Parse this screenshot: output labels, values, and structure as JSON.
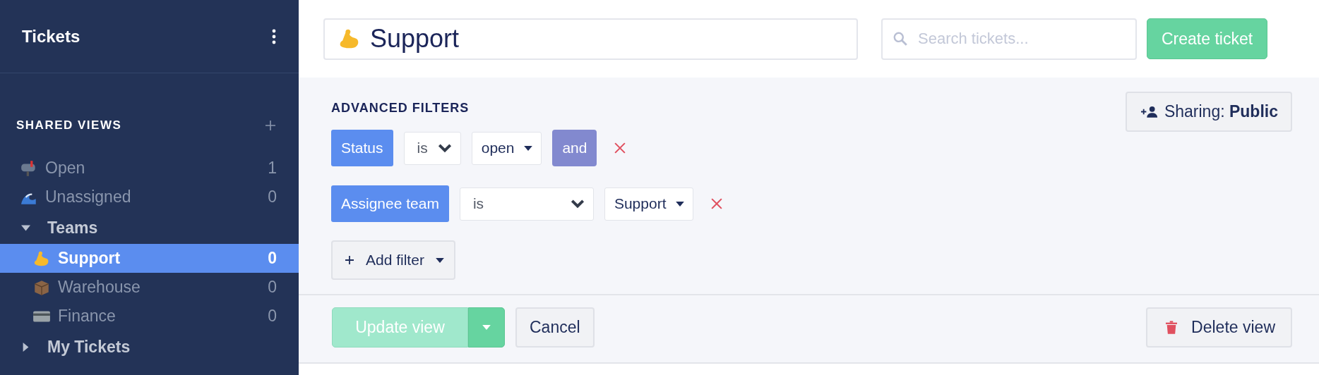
{
  "sidebar": {
    "title": "Tickets",
    "section_title": "SHARED VIEWS",
    "items": [
      {
        "label": "Open",
        "count": "1",
        "selected": false
      },
      {
        "label": "Unassigned",
        "count": "0",
        "selected": false
      },
      {
        "label": "Teams",
        "expanded": true,
        "selected": false,
        "children": [
          {
            "label": "Support",
            "count": "0",
            "selected": true
          },
          {
            "label": "Warehouse",
            "count": "0",
            "selected": false
          },
          {
            "label": "Finance",
            "count": "0",
            "selected": false
          }
        ]
      },
      {
        "label": "My Tickets",
        "expanded": false,
        "selected": false
      }
    ]
  },
  "header": {
    "view_name": "Support",
    "search": {
      "placeholder": "Search tickets..."
    },
    "create_button": "Create ticket"
  },
  "filters": {
    "title": "ADVANCED FILTERS",
    "sharing_label": "Sharing:",
    "sharing_value": "Public",
    "rows": [
      {
        "field": "Status",
        "operator": "is",
        "value": "open",
        "conjunction": "and"
      },
      {
        "field": "Assignee team",
        "operator": "is",
        "value": "Support"
      }
    ],
    "add_button": "Add filter"
  },
  "footer": {
    "update_button": "Update view",
    "update_disabled": true,
    "cancel_button": "Cancel",
    "delete_button": "Delete view"
  }
}
